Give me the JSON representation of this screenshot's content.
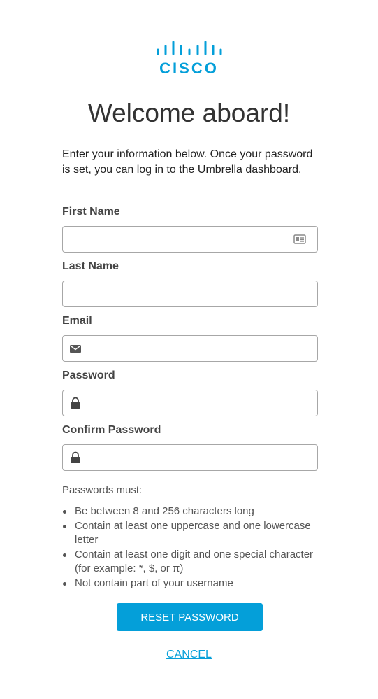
{
  "brand": {
    "logo_text": "CISCO",
    "accent_color": "#049fd9"
  },
  "page": {
    "title": "Welcome aboard!",
    "intro": "Enter your information below. Once your password is set, you can log in to the Umbrella dashboard."
  },
  "form": {
    "first_name": {
      "label": "First Name",
      "value": "",
      "icon": "contact-card-icon"
    },
    "last_name": {
      "label": "Last Name",
      "value": ""
    },
    "email": {
      "label": "Email",
      "value": "",
      "icon": "envelope-icon"
    },
    "password": {
      "label": "Password",
      "value": "",
      "icon": "lock-icon"
    },
    "confirm_password": {
      "label": "Confirm Password",
      "value": "",
      "icon": "lock-icon"
    }
  },
  "rules": {
    "title": "Passwords must:",
    "items": [
      "Be between 8 and 256 characters long",
      "Contain at least one uppercase and one lowercase letter",
      "Contain at least one digit and one special character (for example: *, $, or π)",
      "Not contain part of your username"
    ]
  },
  "actions": {
    "reset_label": "RESET PASSWORD",
    "cancel_label": "CANCEL"
  }
}
